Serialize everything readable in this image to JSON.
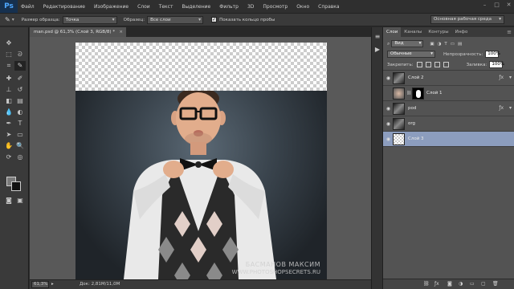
{
  "app": {
    "logo": "Ps"
  },
  "menu": [
    "Файл",
    "Редактирование",
    "Изображение",
    "Слои",
    "Текст",
    "Выделение",
    "Фильтр",
    "3D",
    "Просмотр",
    "Окно",
    "Справка"
  ],
  "options": {
    "sample_size_label": "Размер образца:",
    "sample_size_value": "Точка",
    "sample_label": "Образец:",
    "sample_value": "Все слои",
    "show_ring_label": "Показать кольцо пробы",
    "workspace": "Основная рабочая среда"
  },
  "document": {
    "tab_title": "man.psd @ 61,3% (Слой 3, RGB/8) *",
    "zoom": "61,3%",
    "doc_info": "Док: 2,81M/11,0M"
  },
  "layers_panel": {
    "tabs": [
      "Слои",
      "Каналы",
      "Контуры",
      "Инфо"
    ],
    "kind_filter": "Вид",
    "blend_mode": "Обычные",
    "opacity_label": "Непрозрачность:",
    "opacity_value": "100%",
    "lock_label": "Закрепить:",
    "fill_label": "Заливка:",
    "fill_value": "100%",
    "layers": [
      {
        "name": "Слой 2",
        "visible": true,
        "has_fx": true,
        "has_mask": false,
        "selected": false
      },
      {
        "name": "Слой 1",
        "visible": false,
        "has_fx": false,
        "has_mask": true,
        "selected": false
      },
      {
        "name": "pod",
        "visible": true,
        "has_fx": true,
        "has_mask": false,
        "selected": false
      },
      {
        "name": "org",
        "visible": true,
        "has_fx": false,
        "has_mask": false,
        "selected": false
      },
      {
        "name": "Слой 3",
        "visible": true,
        "has_fx": false,
        "has_mask": false,
        "selected": true
      }
    ]
  },
  "watermark": {
    "line1": "БАСМАНОВ МАКСИМ",
    "line2": "WWW.PHOTOSHOPSECRETS.RU"
  },
  "colors": {
    "selected_layer": "#8c9dbe",
    "photoshop_blue": "#4fa8ff"
  }
}
